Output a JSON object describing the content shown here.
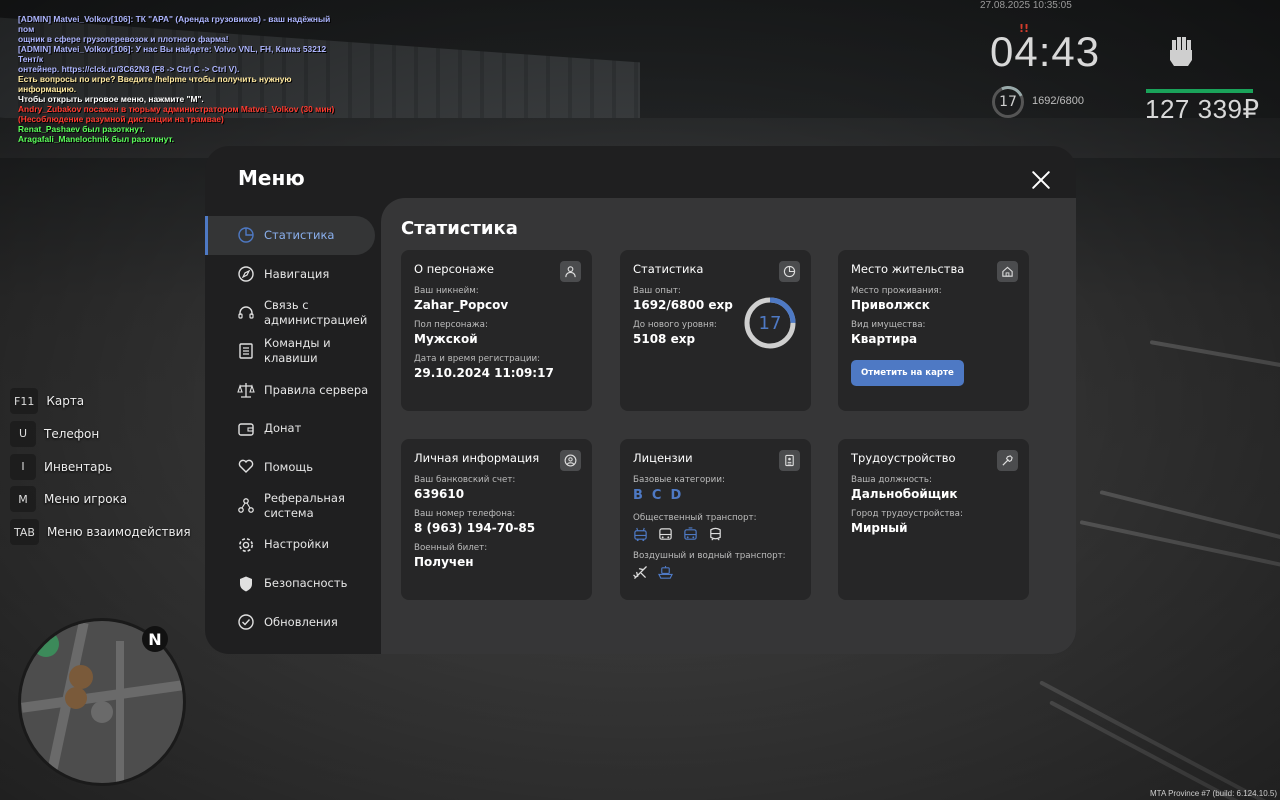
{
  "chat": [
    {
      "text": "[ADMIN] Matvei_Volkov[106]: ТК \"АРА\" (Аренда грузовиков) - ваш надёжный пом",
      "color": "#aeb6ff"
    },
    {
      "text": "ощник в сфере грузоперевозок и плотного фарма!",
      "color": "#aeb6ff"
    },
    {
      "text": "[ADMIN] Matvei_Volkov[106]: У нас Вы найдете: Volvo VNL, FH, Камаз 53212 Тент/к",
      "color": "#aeb6ff"
    },
    {
      "text": "онтейнер. https://clck.ru/3C62N3 (F8 -> Ctrl C -> Ctrl V).",
      "color": "#aeb6ff"
    },
    {
      "text": "Есть вопросы по игре? Введите /helpme чтобы получить нужную информацию.",
      "color": "#ffe9a0"
    },
    {
      "text": "Чтобы открыть игровое меню, нажмите \"M\".",
      "color": "#ffffff"
    },
    {
      "text": "Andry_Zubakov посажен в тюрьму администратором Matvei_Volkov (30 мин)",
      "color": "#ff3b30"
    },
    {
      "text": "(Несоблюдение разумной дистанции на трамвае)",
      "color": "#ff3b30"
    },
    {
      "text": "Renat_Pashaev был разоткнут.",
      "color": "#5bff5b"
    },
    {
      "text": "Aragafali_Manelochnik был разоткнут.",
      "color": "#5bff5b"
    }
  ],
  "hud": {
    "date": "27.08.2025 10:35:05",
    "marker": "!!",
    "time": "04:43",
    "level": "17",
    "exp": "1692/6800",
    "money": "127 339₽",
    "health_fraction": 1.0,
    "health_color": "#1aa35a"
  },
  "hotkeys": [
    {
      "key": "F11",
      "label": "Карта"
    },
    {
      "key": "U",
      "label": "Телефон"
    },
    {
      "key": "I",
      "label": "Инвентарь"
    },
    {
      "key": "M",
      "label": "Меню игрока"
    },
    {
      "key": "TAB",
      "label": "Меню взаимодействия"
    }
  ],
  "minimap": {
    "north": "N"
  },
  "build_info": "MTA Province #7 (build: 6.124.10.5)",
  "menu": {
    "title": "Меню",
    "accent": "#4e79c4",
    "sidebar": [
      {
        "label": "Статистика",
        "icon": "pie-chart-icon",
        "active": true
      },
      {
        "label": "Навигация",
        "icon": "compass-icon",
        "active": false
      },
      {
        "label": "Связь с администрацией",
        "icon": "headset-icon",
        "active": false
      },
      {
        "label": "Команды и клавиши",
        "icon": "document-list-icon",
        "active": false
      },
      {
        "label": "Правила сервера",
        "icon": "scales-icon",
        "active": false
      },
      {
        "label": "Донат",
        "icon": "wallet-icon",
        "active": false
      },
      {
        "label": "Помощь",
        "icon": "heart-hands-icon",
        "active": false
      },
      {
        "label": "Реферальная система",
        "icon": "users-network-icon",
        "active": false
      },
      {
        "label": "Настройки",
        "icon": "gear-icon",
        "active": false
      },
      {
        "label": "Безопасность",
        "icon": "shield-icon",
        "active": false
      },
      {
        "label": "Обновления",
        "icon": "check-circle-icon",
        "active": false
      }
    ],
    "content_title": "Статистика",
    "cards": {
      "character": {
        "title": "О персонаже",
        "icon": "user-icon",
        "nick_label": "Ваш никнейм:",
        "nick": "Zahar_Popcov",
        "gender_label": "Пол персонажа:",
        "gender": "Мужской",
        "reg_label": "Дата и время регистрации:",
        "reg": "29.10.2024 11:09:17"
      },
      "stats": {
        "title": "Статистика",
        "icon": "pie-chart-icon",
        "exp_label": "Ваш опыт:",
        "exp": "1692/6800 exp",
        "next_label": "До нового уровня:",
        "next": "5108 exp",
        "level": "17",
        "progress_fraction": 0.249
      },
      "residence": {
        "title": "Место жительства",
        "icon": "home-icon",
        "place_label": "Место проживания:",
        "place": "Приволжск",
        "property_label": "Вид имущества:",
        "property": "Квартира",
        "button": "Отметить на карте"
      },
      "personal": {
        "title": "Личная информация",
        "icon": "user-circle-icon",
        "bank_label": "Ваш банковский счет:",
        "bank": "639610",
        "phone_label": "Ваш номер телефона:",
        "phone": "8 (963) 194-70-85",
        "military_label": "Военный билет:",
        "military": "Получен"
      },
      "licenses": {
        "title": "Лицензии",
        "icon": "id-card-icon",
        "base_label": "Базовые категории:",
        "categories": [
          "B",
          "C",
          "D"
        ],
        "public_label": "Общественный транспорт:",
        "public_icons": [
          "trolleybus-icon",
          "bus-icon",
          "tram-icon",
          "metro-icon"
        ],
        "air_label": "Воздушный и водный транспорт:",
        "air_icons": [
          "airplane-icon",
          "boat-icon"
        ]
      },
      "job": {
        "title": "Трудоустройство",
        "icon": "hammer-icon",
        "position_label": "Ваша должность:",
        "position": "Дальнобойщик",
        "city_label": "Город трудоустройства:",
        "city": "Мирный"
      }
    }
  }
}
